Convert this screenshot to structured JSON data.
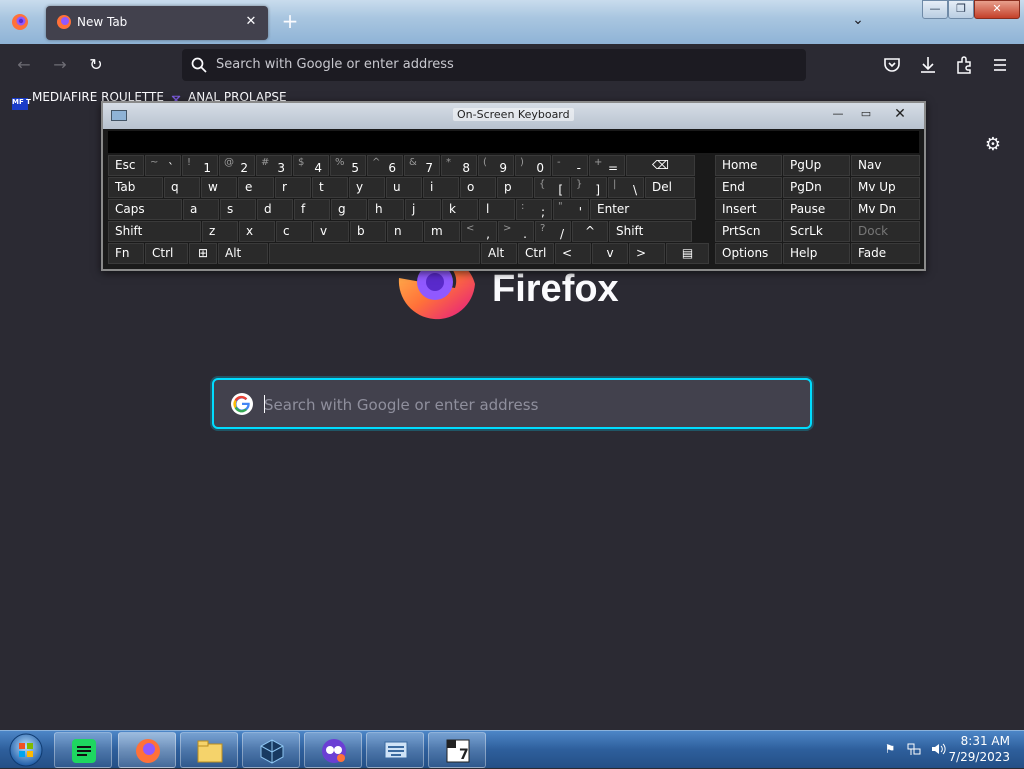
{
  "browser": {
    "tab_title": "New Tab",
    "tab_close": "✕",
    "new_tab": "+",
    "address_placeholder": "Search with Google or enter address",
    "bookmarks": [
      {
        "icon_text": "MF T",
        "label": "MEDIAFIRE ROULETTE"
      },
      {
        "icon_text": "⧖",
        "label": "ANAL PROLAPSE"
      }
    ],
    "icons": {
      "back": "back-arrow-icon",
      "forward": "forward-arrow-icon",
      "reload": "reload-icon",
      "pocket": "pocket-icon",
      "downloads": "download-icon",
      "extensions": "extensions-icon",
      "menu": "hamburger-menu-icon"
    }
  },
  "window_controls": {
    "minimize": "—",
    "maximize": "❐",
    "close": "✕"
  },
  "newtab": {
    "logo_word": "Firefox",
    "search_placeholder": "Search with Google or enter address"
  },
  "osk": {
    "title": "On-Screen Keyboard",
    "controls": {
      "minimize": "—",
      "maximize": "▭",
      "close": "✕"
    },
    "rows": [
      [
        {
          "m": "Esc",
          "w": 37
        },
        {
          "s": "~",
          "m": "`",
          "w": 37
        },
        {
          "s": "!",
          "m": "1",
          "w": 37
        },
        {
          "s": "@",
          "m": "2",
          "w": 37
        },
        {
          "s": "#",
          "m": "3",
          "w": 37
        },
        {
          "s": "$",
          "m": "4",
          "w": 37
        },
        {
          "s": "%",
          "m": "5",
          "w": 37
        },
        {
          "s": "^",
          "m": "6",
          "w": 37
        },
        {
          "s": "&",
          "m": "7",
          "w": 37
        },
        {
          "s": "*",
          "m": "8",
          "w": 37
        },
        {
          "s": "(",
          "m": "9",
          "w": 37
        },
        {
          "s": ")",
          "m": "0",
          "w": 37
        },
        {
          "s": "-",
          "m": "-",
          "w": 37
        },
        {
          "s": "+",
          "m": "=",
          "w": 37
        },
        {
          "m": "⌫",
          "w": 70,
          "c": true
        }
      ],
      [
        {
          "m": "Tab",
          "w": 56
        },
        {
          "m": "q",
          "w": 37
        },
        {
          "m": "w",
          "w": 37
        },
        {
          "m": "e",
          "w": 37
        },
        {
          "m": "r",
          "w": 37
        },
        {
          "m": "t",
          "w": 37
        },
        {
          "m": "y",
          "w": 37
        },
        {
          "m": "u",
          "w": 37
        },
        {
          "m": "i",
          "w": 37
        },
        {
          "m": "o",
          "w": 37
        },
        {
          "m": "p",
          "w": 37
        },
        {
          "s": "{",
          "m": "[",
          "w": 37
        },
        {
          "s": "}",
          "m": "]",
          "w": 37
        },
        {
          "s": "|",
          "m": "\\",
          "w": 37
        },
        {
          "m": "Del",
          "w": 51
        }
      ],
      [
        {
          "m": "Caps",
          "w": 75
        },
        {
          "m": "a",
          "w": 37
        },
        {
          "m": "s",
          "w": 37
        },
        {
          "m": "d",
          "w": 37
        },
        {
          "m": "f",
          "w": 37
        },
        {
          "m": "g",
          "w": 37
        },
        {
          "m": "h",
          "w": 37
        },
        {
          "m": "j",
          "w": 37
        },
        {
          "m": "k",
          "w": 37
        },
        {
          "m": "l",
          "w": 37
        },
        {
          "s": ":",
          "m": ";",
          "w": 37
        },
        {
          "s": "\"",
          "m": "'",
          "w": 37
        },
        {
          "m": "Enter",
          "w": 107
        }
      ],
      [
        {
          "m": "Shift",
          "w": 94
        },
        {
          "m": "z",
          "w": 37
        },
        {
          "m": "x",
          "w": 37
        },
        {
          "m": "c",
          "w": 37
        },
        {
          "m": "v",
          "w": 37
        },
        {
          "m": "b",
          "w": 37
        },
        {
          "m": "n",
          "w": 37
        },
        {
          "m": "m",
          "w": 37
        },
        {
          "s": "<",
          "m": ",",
          "w": 37
        },
        {
          "s": ">",
          "m": ".",
          "w": 37
        },
        {
          "s": "?",
          "m": "/",
          "w": 37
        },
        {
          "m": "^",
          "w": 37,
          "c": true
        },
        {
          "m": "Shift",
          "w": 84
        }
      ],
      [
        {
          "m": "Fn",
          "w": 37
        },
        {
          "m": "Ctrl",
          "w": 44
        },
        {
          "m": "⊞",
          "w": 29,
          "c": true
        },
        {
          "m": "Alt",
          "w": 51
        },
        {
          "m": "",
          "w": 212
        },
        {
          "m": "Alt",
          "w": 37
        },
        {
          "m": "Ctrl",
          "w": 37
        },
        {
          "m": "<",
          "w": 37
        },
        {
          "m": "v",
          "w": 37,
          "c": true
        },
        {
          "m": ">",
          "w": 37
        },
        {
          "m": "▤",
          "w": 44,
          "c": true
        }
      ]
    ],
    "side_rows": [
      [
        "Home",
        "PgUp",
        "Nav"
      ],
      [
        "End",
        "PgDn",
        "Mv Up"
      ],
      [
        "Insert",
        "Pause",
        "Mv Dn"
      ],
      [
        "PrtScn",
        "ScrLk",
        "Dock"
      ],
      [
        "Options",
        "Help",
        "Fade"
      ]
    ]
  },
  "taskbar": {
    "apps": [
      "spotify-icon",
      "firefox-icon",
      "file-explorer-icon",
      "virtualbox-icon",
      "game-icon",
      "on-screen-keyboard-icon",
      "seven-zip-icon"
    ],
    "tray_icons": [
      "flag-icon",
      "network-icon",
      "volume-icon"
    ],
    "time": "8:31 AM",
    "date": "7/29/2023"
  }
}
